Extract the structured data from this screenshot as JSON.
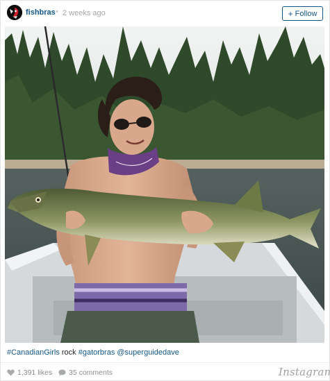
{
  "header": {
    "username": "fishbras",
    "separator": "•",
    "timestamp": "2 weeks ago",
    "follow_label": "Follow",
    "follow_icon": "plus-icon"
  },
  "post": {
    "photo_icon": "post-photo"
  },
  "caption": {
    "tag1": "#CanadianGirls",
    "text1": " rock ",
    "tag2": "#gatorbras",
    "space": " ",
    "mention": "@superguidedave"
  },
  "footer": {
    "likes": "1,391 likes",
    "likes_icon": "heart-icon",
    "comments": "35 comments",
    "comments_icon": "speech-bubble-icon",
    "brand": "Instagram"
  },
  "colors": {
    "link": "#125688",
    "muted": "#a5a7aa",
    "text": "#262626"
  }
}
